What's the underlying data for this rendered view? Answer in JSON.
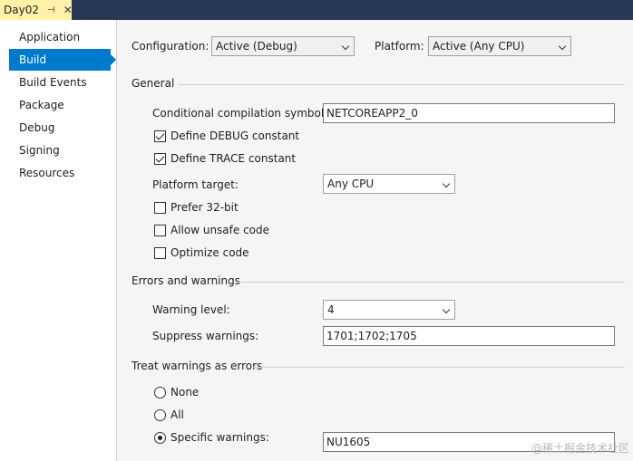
{
  "tab": {
    "title": "Day02",
    "pin": "⊣",
    "close": "✕"
  },
  "nav": {
    "items": [
      {
        "label": "Application"
      },
      {
        "label": "Build"
      },
      {
        "label": "Build Events"
      },
      {
        "label": "Package"
      },
      {
        "label": "Debug"
      },
      {
        "label": "Signing"
      },
      {
        "label": "Resources"
      }
    ],
    "active": "Build"
  },
  "config": {
    "configuration_label": "Configuration:",
    "configuration_value": "Active (Debug)",
    "platform_label": "Platform:",
    "platform_value": "Active (Any CPU)"
  },
  "general": {
    "header": "General",
    "symbols_label": "Conditional compilation symbols:",
    "symbols_value": "NETCOREAPP2_0",
    "define_debug": {
      "label": "Define DEBUG constant",
      "checked": true
    },
    "define_trace": {
      "label": "Define TRACE constant",
      "checked": true
    },
    "platform_target_label": "Platform target:",
    "platform_target_value": "Any CPU",
    "prefer32": {
      "label": "Prefer 32-bit",
      "checked": false
    },
    "unsafe": {
      "label": "Allow unsafe code",
      "checked": false
    },
    "optimize": {
      "label": "Optimize code",
      "checked": false
    }
  },
  "errors": {
    "header": "Errors and warnings",
    "warning_level_label": "Warning level:",
    "warning_level_value": "4",
    "suppress_label": "Suppress warnings:",
    "suppress_value": "1701;1702;1705"
  },
  "treat": {
    "header": "Treat warnings as errors",
    "none": {
      "label": "None",
      "selected": false
    },
    "all": {
      "label": "All",
      "selected": false
    },
    "specific": {
      "label": "Specific warnings:",
      "selected": true
    },
    "specific_value": "NU1605"
  },
  "watermark": "@稀土掘金技术社区"
}
